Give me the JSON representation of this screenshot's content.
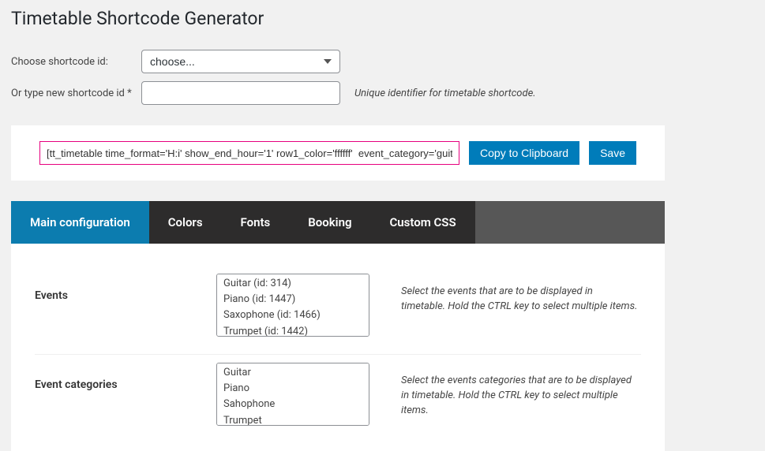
{
  "page_title": "Timetable Shortcode Generator",
  "choose_row": {
    "label": "Choose shortcode id:",
    "selected": "choose..."
  },
  "new_row": {
    "label": "Or type new shortcode id *",
    "value": "",
    "hint": "Unique identifier for timetable shortcode."
  },
  "shortcode": {
    "text": "[tt_timetable time_format='H:i' show_end_hour='1' row1_color='ffffff'  event_category='guit",
    "copy_btn": "Copy to Clipboard",
    "save_btn": "Save"
  },
  "tabs": [
    {
      "label": "Main configuration",
      "active": true
    },
    {
      "label": "Colors",
      "active": false
    },
    {
      "label": "Fonts",
      "active": false
    },
    {
      "label": "Booking",
      "active": false
    },
    {
      "label": "Custom CSS",
      "active": false
    }
  ],
  "fields": {
    "events": {
      "label": "Events",
      "options": [
        "Guitar (id: 314)",
        "Piano (id: 1447)",
        "Saxophone (id: 1466)",
        "Trumpet (id: 1442)"
      ],
      "hint": "Select the events that are to be displayed in timetable. Hold the CTRL key to select multiple items."
    },
    "event_categories": {
      "label": "Event categories",
      "options": [
        "Guitar",
        "Piano",
        "Sahophone",
        "Trumpet"
      ],
      "hint": "Select the events categories that are to be displayed in timetable. Hold the CTRL key to select multiple items."
    }
  }
}
